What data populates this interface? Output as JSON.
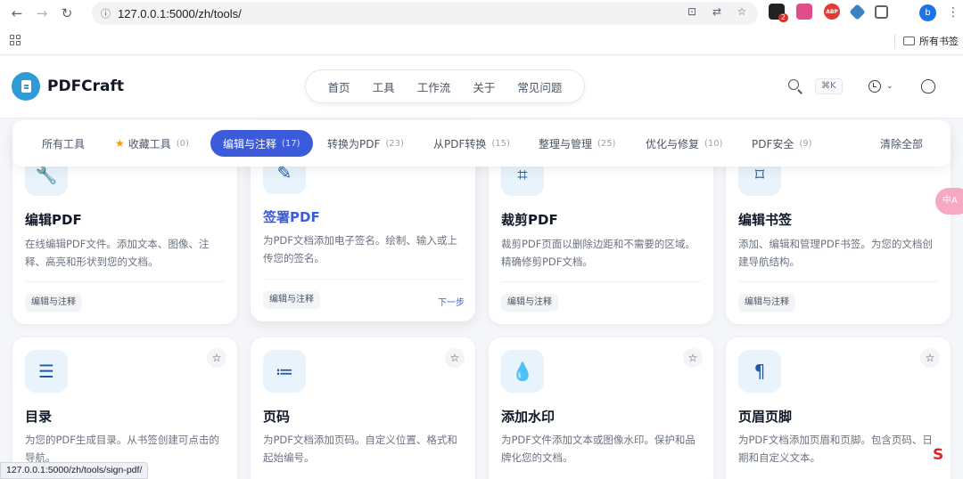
{
  "browser": {
    "url": "127.0.0.1:5000/zh/tools/",
    "all_bookmarks_label": "所有书签",
    "profile_initial": "b",
    "extension_badge": "2",
    "status_url": "127.0.0.1:5000/zh/tools/sign-pdf/"
  },
  "header": {
    "brand": "PDFCraft",
    "nav": [
      "首页",
      "工具",
      "工作流",
      "关于",
      "常见问题"
    ],
    "search_shortcut": "⌘K"
  },
  "tabs": [
    {
      "label": "所有工具",
      "count": ""
    },
    {
      "label": "收藏工具",
      "count": "(0)"
    },
    {
      "label": "编辑与注释",
      "count": "(17)"
    },
    {
      "label": "转换为PDF",
      "count": "(23)"
    },
    {
      "label": "从PDF转换",
      "count": "(15)"
    },
    {
      "label": "整理与管理",
      "count": "(25)"
    },
    {
      "label": "优化与修复",
      "count": "(10)"
    },
    {
      "label": "PDF安全",
      "count": "(9)"
    },
    {
      "label": "清除全部",
      "count": ""
    }
  ],
  "cards": [
    {
      "title": "编辑PDF",
      "desc": "在线编辑PDF文件。添加文本、图像、注释、高亮和形状到您的文档。",
      "tag": "编辑与注释"
    },
    {
      "title": "签署PDF",
      "desc": "为PDF文档添加电子签名。绘制、输入或上传您的签名。",
      "tag": "编辑与注释",
      "next": "下一步"
    },
    {
      "title": "裁剪PDF",
      "desc": "裁剪PDF页面以删除边距和不需要的区域。精确修剪PDF文档。",
      "tag": "编辑与注释"
    },
    {
      "title": "编辑书签",
      "desc": "添加、编辑和管理PDF书签。为您的文档创建导航结构。",
      "tag": "编辑与注释"
    },
    {
      "title": "目录",
      "desc": "为您的PDF生成目录。从书签创建可点击的导航。"
    },
    {
      "title": "页码",
      "desc": "为PDF文档添加页码。自定义位置、格式和起始编号。"
    },
    {
      "title": "添加水印",
      "desc": "为PDF文件添加文本或图像水印。保护和品牌化您的文档。"
    },
    {
      "title": "页眉页脚",
      "desc": "为PDF文档添加页眉和页脚。包含页码、日期和自定义文本。"
    }
  ],
  "floating": {
    "translate_label": "中A",
    "s_logo": "S"
  }
}
